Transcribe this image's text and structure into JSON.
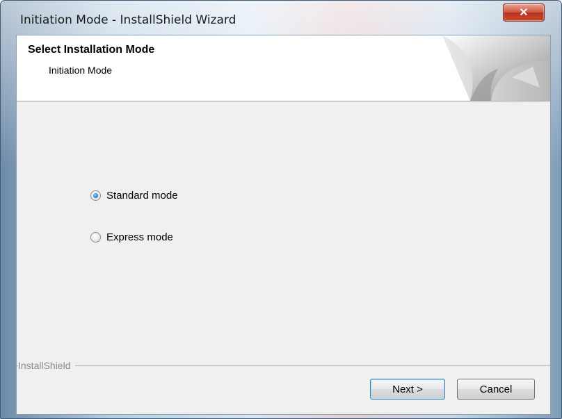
{
  "window": {
    "title": "Initiation Mode - InstallShield Wizard",
    "close_glyph": "✕"
  },
  "header": {
    "title": "Select Installation Mode",
    "subtitle": "Initiation Mode"
  },
  "options": [
    {
      "label": "Standard mode",
      "checked": true
    },
    {
      "label": "Express mode",
      "checked": false
    }
  ],
  "footer": {
    "brand": "InstallShield",
    "next_label": "Next >",
    "cancel_label": "Cancel"
  },
  "colors": {
    "accent": "#2a84d8",
    "close": "#c94a2f"
  }
}
